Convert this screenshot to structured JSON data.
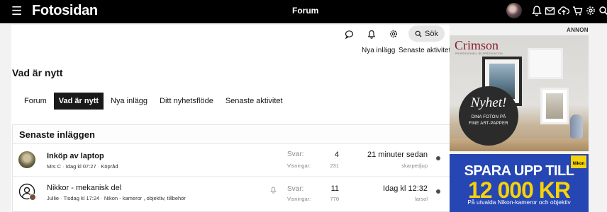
{
  "topbar": {
    "menu_icon": "hamburger-icon",
    "logo": "Fotosidan",
    "title": "Forum",
    "icons": [
      "bell-icon",
      "mail-icon",
      "upload-icon",
      "cart-icon",
      "gear-icon",
      "search-icon"
    ]
  },
  "utility": {
    "icons": [
      "chat-bubble-icon",
      "bell-icon",
      "gear-icon"
    ],
    "search_label": "Sök",
    "link_new_posts": "Nya inlägg",
    "link_latest_activity": "Senaste aktivitet"
  },
  "page_title": "Vad är nytt",
  "tabs": [
    {
      "label": "Forum",
      "active": false
    },
    {
      "label": "Vad är nytt",
      "active": true
    },
    {
      "label": "Nya inlägg",
      "active": false
    },
    {
      "label": "Ditt nyhetsflöde",
      "active": false
    },
    {
      "label": "Senaste aktivitet",
      "active": false
    }
  ],
  "latest": {
    "header": "Senaste inläggen",
    "labels": {
      "replies": "Svar:",
      "views": "Visningar:"
    },
    "rows": [
      {
        "title": "Inköp av laptop",
        "author": "Mrs C",
        "date": "Idag kl 07:27",
        "forum": "Köpråd",
        "replies": "4",
        "views": "231",
        "last_time": "21 minuter sedan",
        "last_user": "skarpedjup"
      },
      {
        "title": "Nikkor - mekanisk del",
        "author": "Jullie",
        "date": "Tisdag kl 17:24",
        "forum": "Nikon - kameror , objektiv, tillbehör",
        "replies": "11",
        "views": "770",
        "last_time": "Idag kl 12:32",
        "last_user": "larsol"
      }
    ]
  },
  "ad": {
    "label": "ANNONS",
    "crimson": {
      "brand": "Crimson",
      "tagline": "PROFESSIONELL BILDPRODUKTION",
      "headline": "Nyhet!",
      "line1": "DINA FOTON PÅ",
      "line2": "FINE ART-PAPPER"
    },
    "nikon": {
      "headline": "SPARA UPP TILL",
      "amount": "12 000 KR",
      "sub": "På utvalda Nikon-kameror och objektiv",
      "logo": "Nikon"
    }
  }
}
